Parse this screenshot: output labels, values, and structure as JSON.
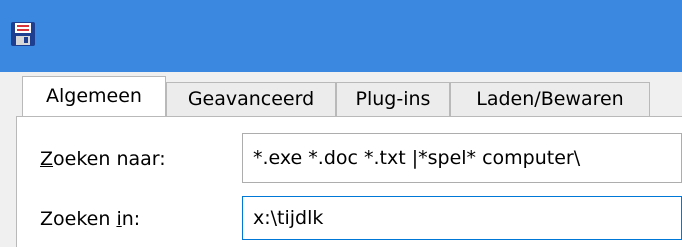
{
  "window": {
    "title_icon": "floppy-disk-icon",
    "titlebar_color": "#3a88e0"
  },
  "tabs": [
    {
      "label": "Algemeen",
      "active": true
    },
    {
      "label": "Geavanceerd",
      "active": false
    },
    {
      "label": "Plug-ins",
      "active": false
    },
    {
      "label": "Laden/Bewaren",
      "active": false
    }
  ],
  "form": {
    "search_for": {
      "label_accel": "Z",
      "label_rest": "oeken naar:",
      "value": "*.exe *.doc *.txt |*spel* computer\\"
    },
    "search_in": {
      "label_pre": "Zoeken ",
      "label_accel": "i",
      "label_post": "n:",
      "value": "x:\\tijdlk"
    }
  }
}
